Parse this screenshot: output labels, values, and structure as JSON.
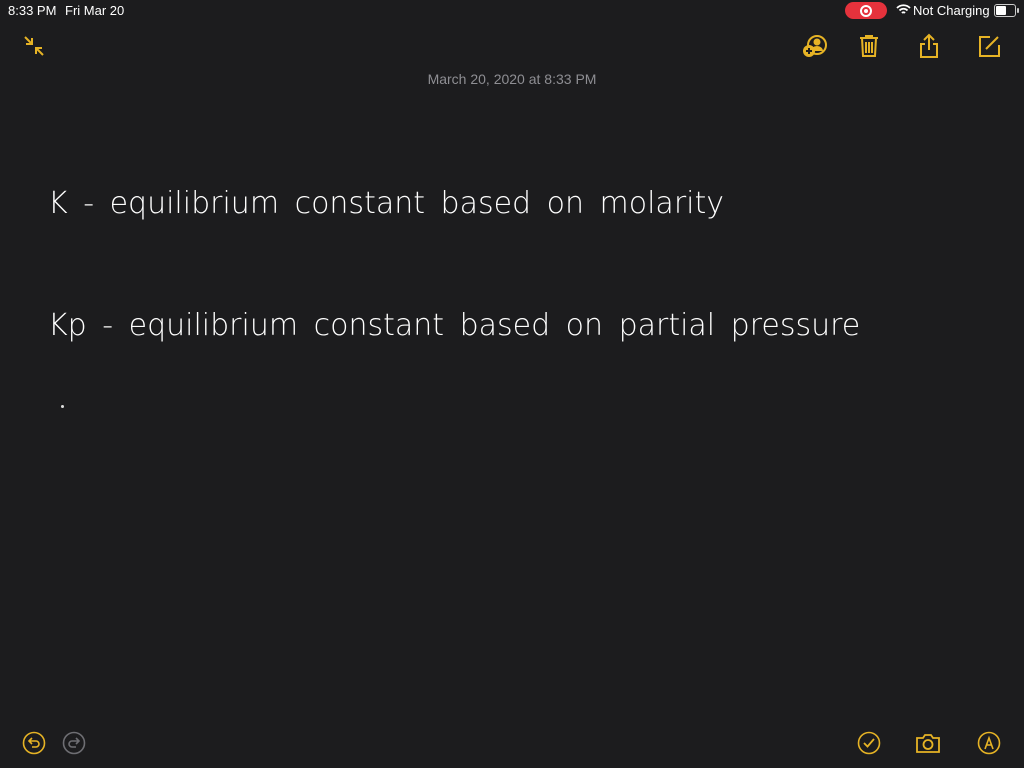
{
  "status_bar": {
    "time": "8:33 PM",
    "date": "Fri Mar 20",
    "battery_text": "Not Charging",
    "icons": [
      "screen-recording-icon",
      "wifi-icon",
      "battery-icon"
    ]
  },
  "toolbar": {
    "left_icons": [
      "collapse-icon"
    ],
    "right_icons": [
      "add-person-icon",
      "trash-icon",
      "share-icon",
      "compose-icon"
    ],
    "accent": "#e6b325"
  },
  "note": {
    "timestamp": "March 20, 2020 at 8:33 PM",
    "lines": [
      "K - equilibrium constant based on molarity",
      "Kp - equilibrium constant based on partial pressure"
    ]
  },
  "bottom_bar": {
    "left_icons": [
      "undo-icon",
      "redo-icon"
    ],
    "right_icons": [
      "checklist-icon",
      "camera-icon",
      "markup-icon"
    ]
  }
}
